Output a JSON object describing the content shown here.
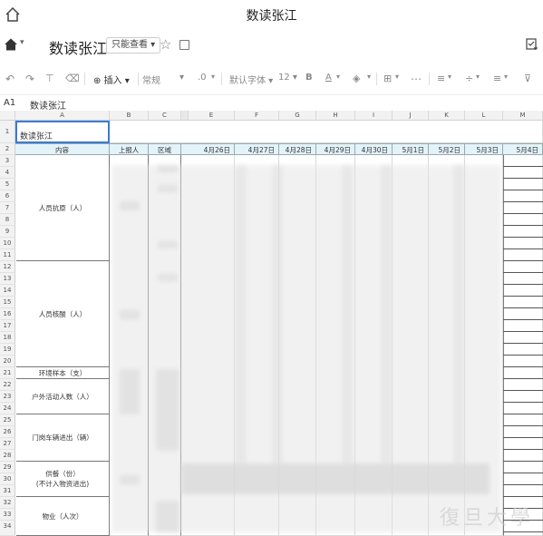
{
  "window": {
    "title": "数读张江"
  },
  "docbar": {
    "name": "数读张江",
    "mode": "只能查看"
  },
  "toolbar": {
    "insert": "插入",
    "format": "常规",
    "decimals": ".0",
    "font": "默认字体",
    "font_size": "12",
    "bold": "B",
    "font_color": "A"
  },
  "formula_bar": {
    "cell_ref": "A1",
    "value": "数读张江"
  },
  "columns": [
    "A",
    "B",
    "C",
    "E",
    "F",
    "G",
    "H",
    "I",
    "J",
    "K",
    "L",
    "M"
  ],
  "rows": [
    "1",
    "2",
    "3",
    "4",
    "5",
    "6",
    "7",
    "8",
    "9",
    "10",
    "11",
    "12",
    "13",
    "14",
    "15",
    "16",
    "17",
    "18",
    "19",
    "20",
    "21",
    "22",
    "23",
    "24",
    "25",
    "26",
    "27",
    "28",
    "29",
    "30",
    "31",
    "32",
    "33",
    "34"
  ],
  "sheet": {
    "a1": "数读张江",
    "header": {
      "content": "内容",
      "reporter": "上报人",
      "c": "区域",
      "dates": [
        "4月26日",
        "4月27日",
        "4月28日",
        "4月29日",
        "4月30日",
        "5月1日",
        "5月2日",
        "5月3日",
        "5月4日"
      ]
    },
    "groups": [
      {
        "label": "人员抗原（人）"
      },
      {
        "label": "人员核酸（人）"
      },
      {
        "label": "环境样本（支）"
      },
      {
        "label": "户外活动人数（人）"
      },
      {
        "label": "门岗车辆进出（辆）"
      },
      {
        "label": "供餐（份）",
        "sub": "(不计入物资进出)"
      },
      {
        "label": "物业（人次）"
      }
    ]
  },
  "watermark": "復旦大學"
}
